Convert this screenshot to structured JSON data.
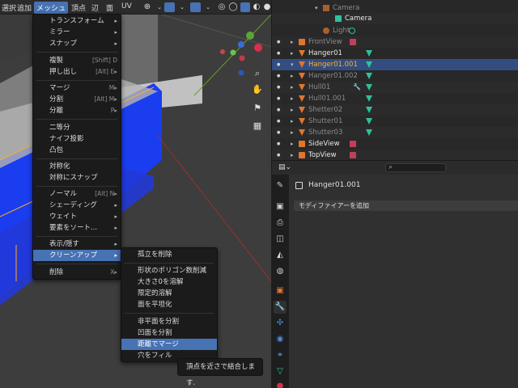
{
  "topbar": {
    "menus": [
      "選択",
      "追加",
      "メッシュ",
      "頂点",
      "辺",
      "面",
      "UV"
    ]
  },
  "mesh_menu": {
    "items": [
      {
        "label": "トランスフォーム",
        "arrow": "▸"
      },
      {
        "label": "ミラー",
        "arrow": "▸"
      },
      {
        "label": "スナップ",
        "arrow": "▸"
      },
      {
        "label": "複製",
        "shortcut": "[Shift] D"
      },
      {
        "label": "押し出し",
        "shortcut": "[Alt] E▸"
      },
      {
        "label": "マージ",
        "shortcut": "M▸"
      },
      {
        "label": "分割",
        "shortcut": "[Alt] M▸"
      },
      {
        "label": "分離",
        "shortcut": "P▸"
      },
      {
        "label": "二等分"
      },
      {
        "label": "ナイフ投影"
      },
      {
        "label": "凸包"
      },
      {
        "label": "対称化"
      },
      {
        "label": "対称にスナップ"
      },
      {
        "label": "ノーマル",
        "shortcut": "[Alt] N▸"
      },
      {
        "label": "シェーディング",
        "arrow": "▸"
      },
      {
        "label": "ウェイト",
        "arrow": "▸"
      },
      {
        "label": "要素をソート...",
        "arrow": "▸"
      },
      {
        "label": "表示/隠す",
        "arrow": "▸"
      },
      {
        "label": "クリーンアップ",
        "arrow": "▸"
      },
      {
        "label": "削除",
        "shortcut": "X▸"
      }
    ]
  },
  "cleanup_menu": {
    "items": [
      {
        "label": "孤立を削除"
      },
      {
        "label": "形状のポリゴン数削減"
      },
      {
        "label": "大きさ0を溶解"
      },
      {
        "label": "限定的溶解"
      },
      {
        "label": "面を平坦化"
      },
      {
        "label": "非平面を分割"
      },
      {
        "label": "凹面を分割"
      },
      {
        "label": "距離でマージ"
      },
      {
        "label": "穴をフィル"
      }
    ]
  },
  "tooltip": {
    "text": "頂点を近さで結合します."
  },
  "outliner": {
    "rows": [
      {
        "name": "Camera"
      },
      {
        "name": "Camera"
      },
      {
        "name": "Light"
      },
      {
        "name": "FrontView"
      },
      {
        "name": "Hanger01"
      },
      {
        "name": "Hanger01.001"
      },
      {
        "name": "Hanger01.002"
      },
      {
        "name": "Hull01"
      },
      {
        "name": "Hull01.001"
      },
      {
        "name": "Shetter02"
      },
      {
        "name": "Shutter01"
      },
      {
        "name": "Shutter03"
      },
      {
        "name": "SideView"
      },
      {
        "name": "TopView"
      }
    ]
  },
  "properties": {
    "object_name": "Hanger01.001",
    "add_modifier_label": "モディファイアーを追加"
  },
  "colors": {
    "accent": "#4772b3",
    "selected_text": "#ffaf29",
    "mesh_blue": "#1a3df0",
    "mesh_green": "#30c09a",
    "image_orange": "#e0762f"
  }
}
